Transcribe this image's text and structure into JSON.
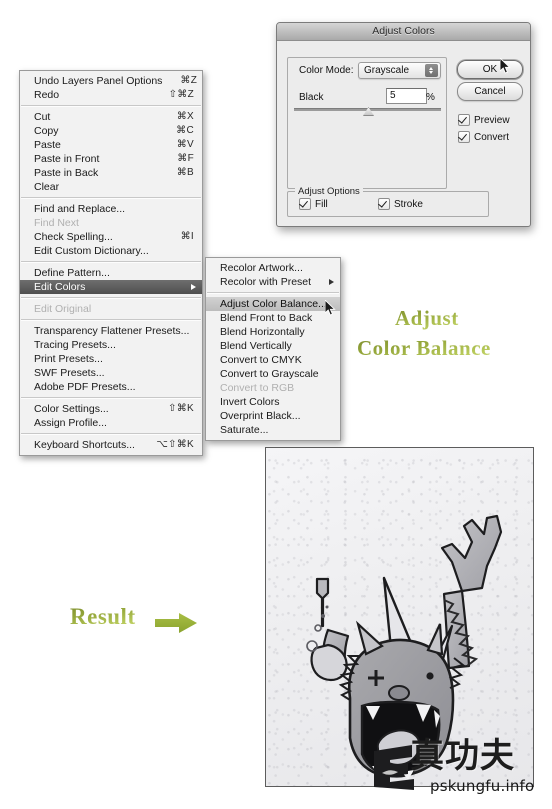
{
  "dialog": {
    "title": "Adjust Colors",
    "color_mode_label": "Color Mode:",
    "color_mode_value": "Grayscale",
    "black_label": "Black",
    "black_value": "5",
    "percent_symbol": "%",
    "ok_label": "OK",
    "cancel_label": "Cancel",
    "preview_label": "Preview",
    "preview_checked": true,
    "convert_label": "Convert",
    "convert_checked": true,
    "adjust_options_label": "Adjust Options",
    "fill_label": "Fill",
    "fill_checked": true,
    "stroke_label": "Stroke",
    "stroke_checked": true
  },
  "edit_menu": {
    "groups": [
      [
        {
          "label": "Undo Layers Panel Options",
          "shortcut": "⌘Z",
          "state": "normal"
        },
        {
          "label": "Redo",
          "shortcut": "⇧⌘Z",
          "state": "normal"
        }
      ],
      [
        {
          "label": "Cut",
          "shortcut": "⌘X",
          "state": "normal"
        },
        {
          "label": "Copy",
          "shortcut": "⌘C",
          "state": "normal"
        },
        {
          "label": "Paste",
          "shortcut": "⌘V",
          "state": "normal"
        },
        {
          "label": "Paste in Front",
          "shortcut": "⌘F",
          "state": "normal"
        },
        {
          "label": "Paste in Back",
          "shortcut": "⌘B",
          "state": "normal"
        },
        {
          "label": "Clear",
          "shortcut": "",
          "state": "normal"
        }
      ],
      [
        {
          "label": "Find and Replace...",
          "shortcut": "",
          "state": "normal"
        },
        {
          "label": "Find Next",
          "shortcut": "",
          "state": "disabled"
        },
        {
          "label": "Check Spelling...",
          "shortcut": "⌘I",
          "state": "normal"
        },
        {
          "label": "Edit Custom Dictionary...",
          "shortcut": "",
          "state": "normal"
        }
      ],
      [
        {
          "label": "Define Pattern...",
          "shortcut": "",
          "state": "normal"
        },
        {
          "label": "Edit Colors",
          "shortcut": "",
          "state": "selected",
          "submenu": true
        }
      ],
      [
        {
          "label": "Edit Original",
          "shortcut": "",
          "state": "disabled"
        }
      ],
      [
        {
          "label": "Transparency Flattener Presets...",
          "shortcut": "",
          "state": "normal"
        },
        {
          "label": "Tracing Presets...",
          "shortcut": "",
          "state": "normal"
        },
        {
          "label": "Print Presets...",
          "shortcut": "",
          "state": "normal"
        },
        {
          "label": "SWF Presets...",
          "shortcut": "",
          "state": "normal"
        },
        {
          "label": "Adobe PDF Presets...",
          "shortcut": "",
          "state": "normal"
        }
      ],
      [
        {
          "label": "Color Settings...",
          "shortcut": "⇧⌘K",
          "state": "normal"
        },
        {
          "label": "Assign Profile...",
          "shortcut": "",
          "state": "normal"
        }
      ],
      [
        {
          "label": "Keyboard Shortcuts...",
          "shortcut": "⌥⇧⌘K",
          "state": "normal"
        }
      ]
    ]
  },
  "edit_colors_submenu": {
    "groups": [
      [
        {
          "label": "Recolor Artwork...",
          "state": "normal"
        },
        {
          "label": "Recolor with Preset",
          "state": "normal",
          "submenu": true
        }
      ],
      [
        {
          "label": "Adjust Color Balance...",
          "state": "highlighted"
        },
        {
          "label": "Blend Front to Back",
          "state": "normal"
        },
        {
          "label": "Blend Horizontally",
          "state": "normal"
        },
        {
          "label": "Blend Vertically",
          "state": "normal"
        },
        {
          "label": "Convert to CMYK",
          "state": "normal"
        },
        {
          "label": "Convert to Grayscale",
          "state": "normal"
        },
        {
          "label": "Convert to RGB",
          "state": "disabled"
        },
        {
          "label": "Invert Colors",
          "state": "normal"
        },
        {
          "label": "Overprint Black...",
          "state": "normal"
        },
        {
          "label": "Saturate...",
          "state": "normal"
        }
      ]
    ]
  },
  "annotations": {
    "adjust": "Adjust",
    "color_balance": "Color Balance",
    "result": "Result",
    "green_color": "#93a53a"
  },
  "watermark": {
    "chinese": "真功夫",
    "site": "pskungfu.info"
  },
  "illustration": {
    "description": "Grayscale cartoon monster holding a bottle"
  }
}
